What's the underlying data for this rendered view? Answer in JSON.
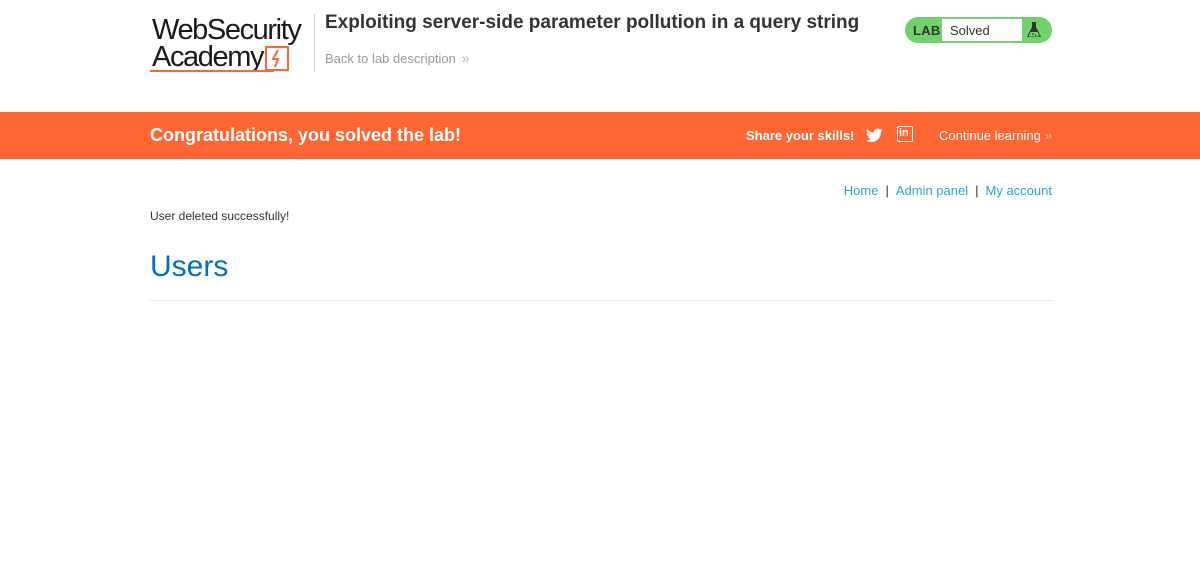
{
  "header": {
    "logo": {
      "line1": "WebSecurity",
      "line2": "Academy"
    },
    "lab_title": "Exploiting server-side parameter pollution in a query string",
    "back_link": "Back to lab description",
    "back_chevron": "»",
    "lab_badge": {
      "label": "LAB",
      "status": "Solved",
      "icon": "flask-icon"
    }
  },
  "banner": {
    "message": "Congratulations, you solved the lab!",
    "share": "Share your skills!",
    "icons": [
      "twitter-icon",
      "linkedin-icon"
    ],
    "linkedin_glyph": "in",
    "continue": "Continue learning",
    "continue_chevron": "»"
  },
  "nav": {
    "home": "Home",
    "admin_panel": "Admin panel",
    "my_account": "My account",
    "separator": "|"
  },
  "main": {
    "message": "User deleted successfully!",
    "heading": "Users"
  },
  "colors": {
    "accent_orange": "#ff6633",
    "status_green": "#70d16d",
    "heading_blue": "#0071bc",
    "link_blue": "#29a3d9"
  }
}
